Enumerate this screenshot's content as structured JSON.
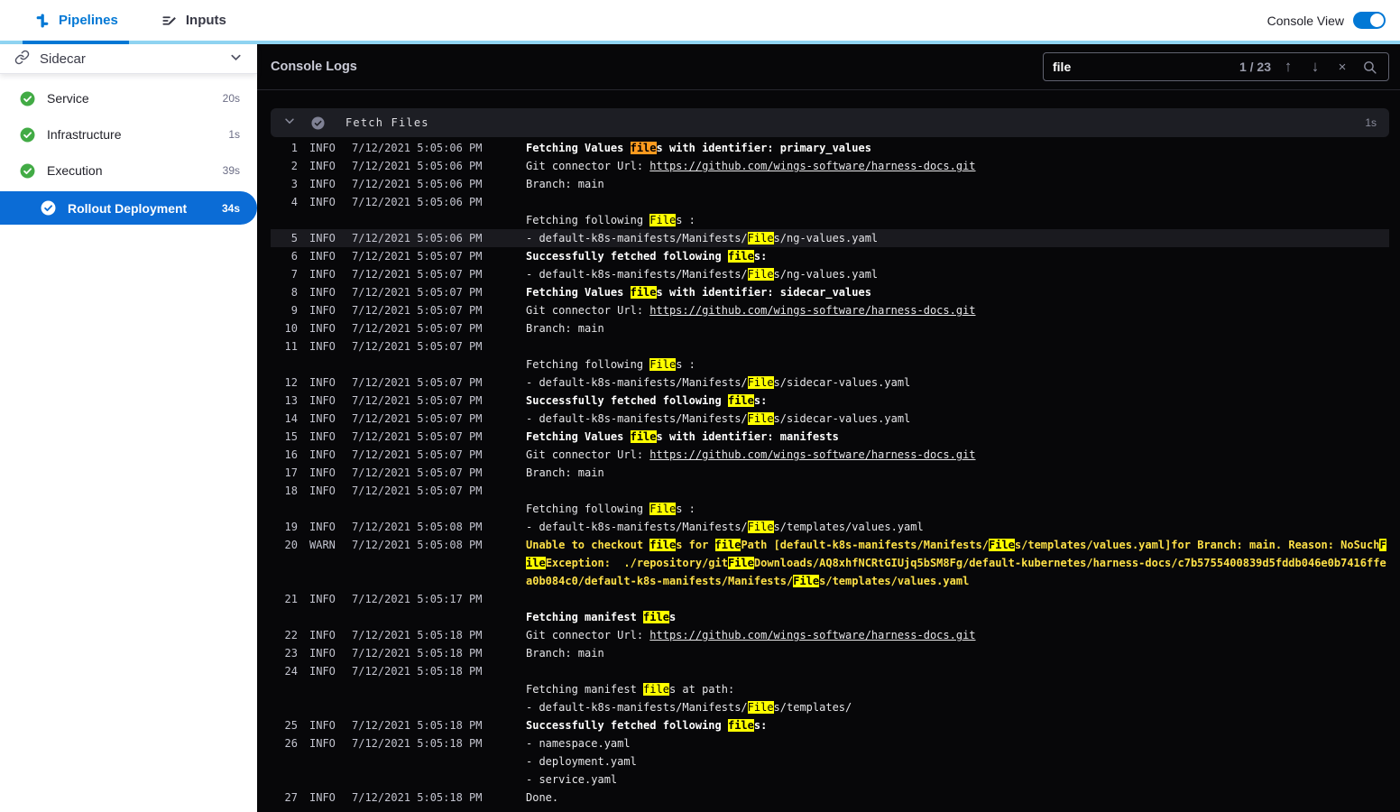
{
  "topbar": {
    "tabs": [
      {
        "label": "Pipelines",
        "active": true
      },
      {
        "label": "Inputs",
        "active": false
      }
    ],
    "console_view_label": "Console View",
    "console_view_on": true
  },
  "sidebar": {
    "stage": {
      "label": "Sidecar"
    },
    "steps": [
      {
        "label": "Service",
        "duration": "20s",
        "status": "success",
        "selected": false
      },
      {
        "label": "Infrastructure",
        "duration": "1s",
        "status": "success",
        "selected": false
      },
      {
        "label": "Execution",
        "duration": "39s",
        "status": "success",
        "selected": false
      },
      {
        "label": "Rollout Deployment",
        "duration": "34s",
        "status": "success",
        "selected": true
      }
    ]
  },
  "console": {
    "title": "Console Logs",
    "search": {
      "value": "file",
      "counter": "1 / 23",
      "term": "file",
      "current_match": 1
    },
    "section": {
      "title": "Fetch Files",
      "duration": "1s"
    },
    "logs": [
      {
        "num": "1",
        "level": "INFO",
        "time": "7/12/2021 5:05:06 PM",
        "lines": [
          {
            "text": "Fetching Values files with identifier: primary_values",
            "style": "bold"
          }
        ]
      },
      {
        "num": "2",
        "level": "INFO",
        "time": "7/12/2021 5:05:06 PM",
        "lines": [
          {
            "prefix": "Git connector Url: ",
            "link": "https://github.com/wings-software/harness-docs.git"
          }
        ]
      },
      {
        "num": "3",
        "level": "INFO",
        "time": "7/12/2021 5:05:06 PM",
        "lines": [
          {
            "text": "Branch: main"
          }
        ]
      },
      {
        "num": "4",
        "level": "INFO",
        "time": "7/12/2021 5:05:06 PM",
        "lines": [
          {
            "text": ""
          },
          {
            "text": "Fetching following Files :"
          }
        ]
      },
      {
        "num": "5",
        "level": "INFO",
        "time": "7/12/2021 5:05:06 PM",
        "highlight": true,
        "lines": [
          {
            "text": "- default-k8s-manifests/Manifests/Files/ng-values.yaml"
          }
        ]
      },
      {
        "num": "6",
        "level": "INFO",
        "time": "7/12/2021 5:05:07 PM",
        "lines": [
          {
            "text": "Successfully fetched following files:",
            "style": "bold"
          }
        ]
      },
      {
        "num": "7",
        "level": "INFO",
        "time": "7/12/2021 5:05:07 PM",
        "lines": [
          {
            "text": "- default-k8s-manifests/Manifests/Files/ng-values.yaml"
          }
        ]
      },
      {
        "num": "8",
        "level": "INFO",
        "time": "7/12/2021 5:05:07 PM",
        "lines": [
          {
            "text": "Fetching Values files with identifier: sidecar_values",
            "style": "bold"
          }
        ]
      },
      {
        "num": "9",
        "level": "INFO",
        "time": "7/12/2021 5:05:07 PM",
        "lines": [
          {
            "prefix": "Git connector Url: ",
            "link": "https://github.com/wings-software/harness-docs.git"
          }
        ]
      },
      {
        "num": "10",
        "level": "INFO",
        "time": "7/12/2021 5:05:07 PM",
        "lines": [
          {
            "text": "Branch: main"
          }
        ]
      },
      {
        "num": "11",
        "level": "INFO",
        "time": "7/12/2021 5:05:07 PM",
        "lines": [
          {
            "text": ""
          },
          {
            "text": "Fetching following Files :"
          }
        ]
      },
      {
        "num": "12",
        "level": "INFO",
        "time": "7/12/2021 5:05:07 PM",
        "lines": [
          {
            "text": "- default-k8s-manifests/Manifests/Files/sidecar-values.yaml"
          }
        ]
      },
      {
        "num": "13",
        "level": "INFO",
        "time": "7/12/2021 5:05:07 PM",
        "lines": [
          {
            "text": "Successfully fetched following files:",
            "style": "bold"
          }
        ]
      },
      {
        "num": "14",
        "level": "INFO",
        "time": "7/12/2021 5:05:07 PM",
        "lines": [
          {
            "text": "- default-k8s-manifests/Manifests/Files/sidecar-values.yaml"
          }
        ]
      },
      {
        "num": "15",
        "level": "INFO",
        "time": "7/12/2021 5:05:07 PM",
        "lines": [
          {
            "text": "Fetching Values files with identifier: manifests",
            "style": "bold"
          }
        ]
      },
      {
        "num": "16",
        "level": "INFO",
        "time": "7/12/2021 5:05:07 PM",
        "lines": [
          {
            "prefix": "Git connector Url: ",
            "link": "https://github.com/wings-software/harness-docs.git"
          }
        ]
      },
      {
        "num": "17",
        "level": "INFO",
        "time": "7/12/2021 5:05:07 PM",
        "lines": [
          {
            "text": "Branch: main"
          }
        ]
      },
      {
        "num": "18",
        "level": "INFO",
        "time": "7/12/2021 5:05:07 PM",
        "lines": [
          {
            "text": ""
          },
          {
            "text": "Fetching following Files :"
          }
        ]
      },
      {
        "num": "19",
        "level": "INFO",
        "time": "7/12/2021 5:05:08 PM",
        "lines": [
          {
            "text": "- default-k8s-manifests/Manifests/Files/templates/values.yaml"
          }
        ]
      },
      {
        "num": "20",
        "level": "WARN",
        "time": "7/12/2021 5:05:08 PM",
        "lines": [
          {
            "text": "Unable to checkout files for filePath [default-k8s-manifests/Manifests/Files/templates/values.yaml]for Branch: main. Reason: NoSuchFileException:  ./repository/gitFileDownloads/AQ8xhfNCRtGIUjq5bSM8Fg/default-kubernetes/harness-docs/c7b5755400839d5fddb046e0b7416ffea0b084c0/default-k8s-manifests/Manifests/Files/templates/values.yaml",
            "style": "warn"
          }
        ]
      },
      {
        "num": "21",
        "level": "INFO",
        "time": "7/12/2021 5:05:17 PM",
        "lines": [
          {
            "text": ""
          },
          {
            "text": "Fetching manifest files",
            "style": "bold"
          }
        ]
      },
      {
        "num": "22",
        "level": "INFO",
        "time": "7/12/2021 5:05:18 PM",
        "lines": [
          {
            "prefix": "Git connector Url: ",
            "link": "https://github.com/wings-software/harness-docs.git"
          }
        ]
      },
      {
        "num": "23",
        "level": "INFO",
        "time": "7/12/2021 5:05:18 PM",
        "lines": [
          {
            "text": "Branch: main"
          }
        ]
      },
      {
        "num": "24",
        "level": "INFO",
        "time": "7/12/2021 5:05:18 PM",
        "lines": [
          {
            "text": ""
          },
          {
            "text": "Fetching manifest files at path:"
          },
          {
            "text": "- default-k8s-manifests/Manifests/Files/templates/"
          }
        ]
      },
      {
        "num": "25",
        "level": "INFO",
        "time": "7/12/2021 5:05:18 PM",
        "lines": [
          {
            "text": "Successfully fetched following files:",
            "style": "bold"
          }
        ]
      },
      {
        "num": "26",
        "level": "INFO",
        "time": "7/12/2021 5:05:18 PM",
        "lines": [
          {
            "text": "- namespace.yaml"
          },
          {
            "text": "- deployment.yaml"
          },
          {
            "text": "- service.yaml"
          }
        ]
      },
      {
        "num": "27",
        "level": "INFO",
        "time": "7/12/2021 5:05:18 PM",
        "lines": [
          {
            "text": "Done."
          }
        ]
      }
    ]
  },
  "colors": {
    "accent": "#0278d5",
    "success_green": "#42ab45",
    "selected_blue": "#0b6cd6",
    "warn_text": "#fde047",
    "match_bg": "#ffff00",
    "current_match_bg": "#ff9a1f"
  }
}
